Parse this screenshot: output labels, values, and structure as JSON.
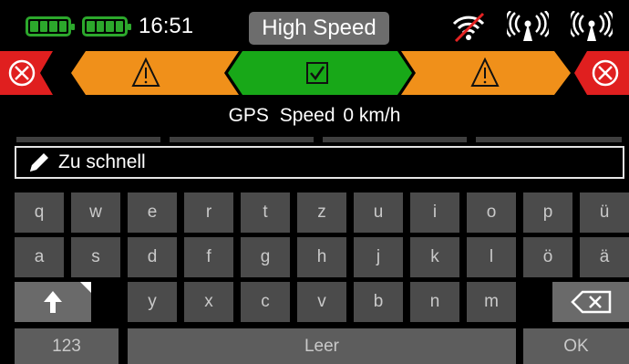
{
  "status": {
    "clock": "16:51",
    "mode": "High Speed",
    "battery_1_icon": "battery-full-icon",
    "battery_2_icon": "battery-full-icon",
    "icons": [
      "wifi-off-icon",
      "antenna-signal-icon",
      "antenna-signal-icon"
    ]
  },
  "alarm_strip": {
    "segments": [
      "error",
      "warning",
      "ok",
      "warning",
      "error"
    ],
    "colors": {
      "error": "#e01f1f",
      "warning": "#f0901a",
      "ok": "#18a818"
    }
  },
  "gps": {
    "label": "GPS",
    "quantity": "Speed",
    "value": "0 km/h"
  },
  "input": {
    "value": "Zu schnell",
    "icon": "pencil-icon"
  },
  "keyboard": {
    "row1": [
      "q",
      "w",
      "e",
      "r",
      "t",
      "z",
      "u",
      "i",
      "o",
      "p",
      "ü"
    ],
    "row2": [
      "a",
      "s",
      "d",
      "f",
      "g",
      "h",
      "j",
      "k",
      "l",
      "ö",
      "ä"
    ],
    "row3": [
      "y",
      "x",
      "c",
      "v",
      "b",
      "n",
      "m"
    ],
    "shift_icon": "shift-arrow-icon",
    "backspace_icon": "backspace-icon",
    "numbers_label": "123",
    "space_label": "Leer",
    "ok_label": "OK"
  }
}
